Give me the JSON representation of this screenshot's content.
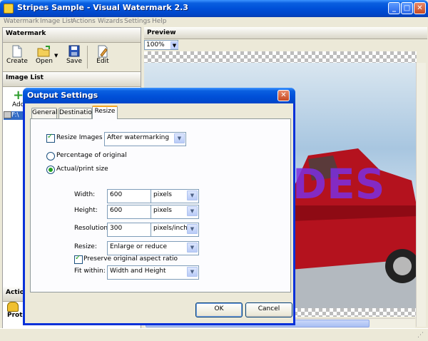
{
  "window": {
    "title": "Stripes Sample - Visual Watermark 2.3"
  },
  "menu": [
    "Watermark",
    "Image List",
    "Actions",
    "Wizards",
    "Settings",
    "Help"
  ],
  "watermark_section": {
    "title": "Watermark",
    "tools": [
      {
        "label": "Create",
        "icon": "create-page-icon"
      },
      {
        "label": "Open",
        "icon": "open-folder-icon"
      },
      {
        "label": "Save",
        "icon": "save-disk-icon"
      },
      {
        "label": "Edit",
        "icon": "edit-page-icon"
      }
    ]
  },
  "image_list_section": {
    "title": "Image List",
    "add_label": "Add",
    "item_text": "F:\\"
  },
  "actions_section": {
    "title": "Actio",
    "protect_label": "Prote"
  },
  "preview": {
    "title": "Preview",
    "zoom": "100%"
  },
  "dialog": {
    "title": "Output Settings",
    "tabs": [
      "General",
      "Destination",
      "Resize"
    ],
    "active_tab": "Resize",
    "resize_images_label": "Resize Images",
    "resize_images_checked": true,
    "resize_timing": "After watermarking",
    "mode_options": [
      "Percentage of original",
      "Actual/print size"
    ],
    "mode_selected": "Actual/print size",
    "width_label": "Width:",
    "width_value": "600",
    "width_unit": "pixels",
    "height_label": "Height:",
    "height_value": "600",
    "height_unit": "pixels",
    "resolution_label": "Resolution:",
    "resolution_value": "300",
    "resolution_unit": "pixels/inch",
    "resize_label": "Resize:",
    "resize_value": "Enlarge or reduce",
    "preserve_label": "Preserve original aspect ratio",
    "preserve_checked": true,
    "fit_label": "Fit within:",
    "fit_value": "Width and Height",
    "ok_label": "OK",
    "cancel_label": "Cancel"
  },
  "colors": {
    "xp_blue": "#0050d8",
    "accent_orange": "#f5a623",
    "check_green": "#21a121"
  }
}
